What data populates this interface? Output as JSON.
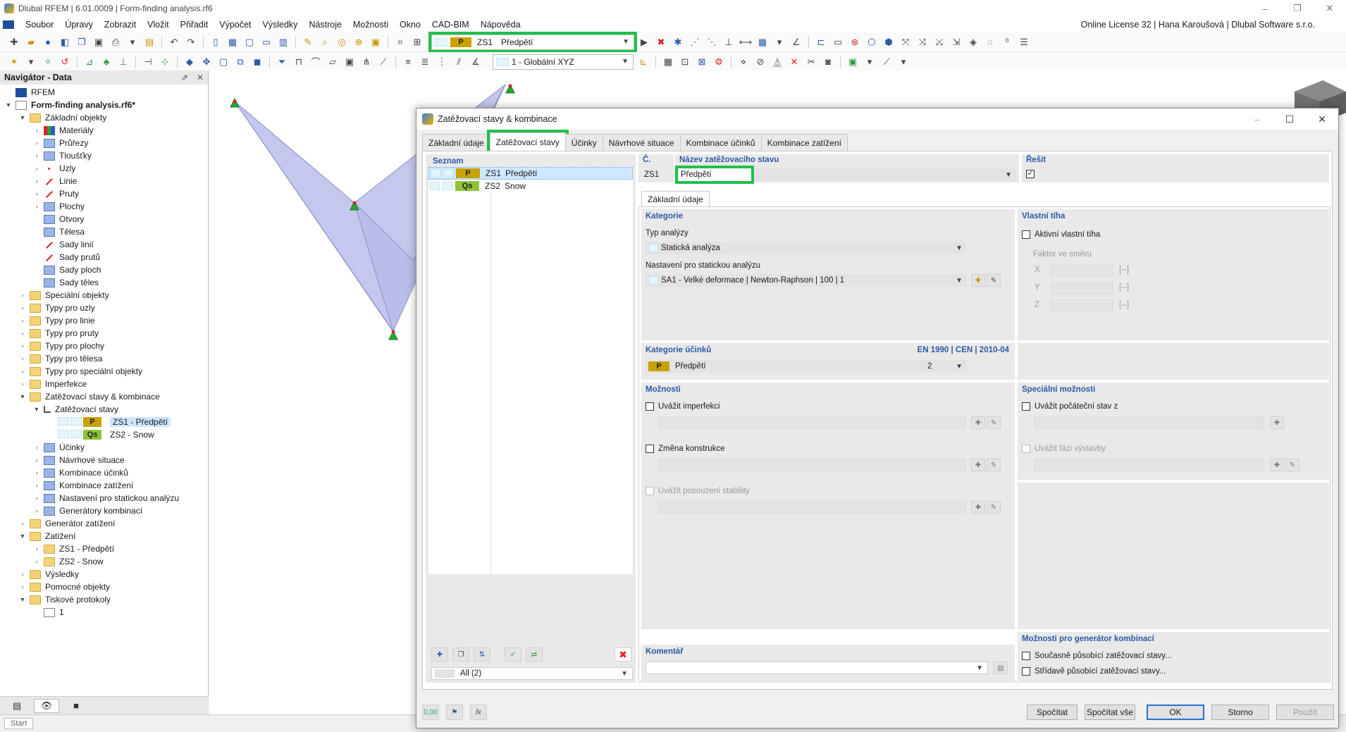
{
  "window": {
    "title": "Dlubal RFEM | 6.01.0009 | Form-finding analysis.rf6",
    "controls": [
      "–",
      "❐",
      "✕"
    ]
  },
  "menu": {
    "items": [
      "Soubor",
      "Úpravy",
      "Zobrazit",
      "Vložit",
      "Přiřadit",
      "Výpočet",
      "Výsledky",
      "Nástroje",
      "Možnosti",
      "Okno",
      "CAD-BIM",
      "Nápověda"
    ],
    "license": "Online License 32 | Hana Karoušová | Dlubal Software s.r.o."
  },
  "toolbar": {
    "lc_selector": {
      "tag": "P",
      "code": "ZS1",
      "name": "Předpětí"
    },
    "coord_system": "1 - Globální XYZ"
  },
  "navigator": {
    "title": "Navigátor - Data",
    "tree": [
      {
        "label": "RFEM",
        "level": 0,
        "exp": "",
        "icon": "rfem"
      },
      {
        "label": "Form-finding analysis.rf6*",
        "level": 0,
        "exp": "▼",
        "icon": "file",
        "bold": true
      },
      {
        "label": "Základní objekty",
        "level": 1,
        "exp": "▼",
        "icon": "folder"
      },
      {
        "label": "Materiály",
        "level": 2,
        "exp": "›",
        "icon": "mat"
      },
      {
        "label": "Průřezy",
        "level": 2,
        "exp": "›",
        "icon": "gen"
      },
      {
        "label": "Tloušťky",
        "level": 2,
        "exp": "›",
        "icon": "gen"
      },
      {
        "label": "Uzly",
        "level": 2,
        "exp": "›",
        "icon": "dot"
      },
      {
        "label": "Linie",
        "level": 2,
        "exp": "›",
        "icon": "red"
      },
      {
        "label": "Pruty",
        "level": 2,
        "exp": "›",
        "icon": "red"
      },
      {
        "label": "Plochy",
        "level": 2,
        "exp": "›",
        "icon": "gen"
      },
      {
        "label": "Otvory",
        "level": 2,
        "exp": "",
        "icon": "gen"
      },
      {
        "label": "Tělesa",
        "level": 2,
        "exp": "",
        "icon": "gen"
      },
      {
        "label": "Sady linií",
        "level": 2,
        "exp": "",
        "icon": "red"
      },
      {
        "label": "Sady prutů",
        "level": 2,
        "exp": "",
        "icon": "red"
      },
      {
        "label": "Sady ploch",
        "level": 2,
        "exp": "",
        "icon": "gen"
      },
      {
        "label": "Sady těles",
        "level": 2,
        "exp": "",
        "icon": "gen"
      },
      {
        "label": "Speciální objekty",
        "level": 1,
        "exp": "›",
        "icon": "folder"
      },
      {
        "label": "Typy pro uzly",
        "level": 1,
        "exp": "›",
        "icon": "folder"
      },
      {
        "label": "Typy pro linie",
        "level": 1,
        "exp": "›",
        "icon": "folder"
      },
      {
        "label": "Typy pro pruty",
        "level": 1,
        "exp": "›",
        "icon": "folder"
      },
      {
        "label": "Typy pro plochy",
        "level": 1,
        "exp": "›",
        "icon": "folder"
      },
      {
        "label": "Typy pro tělesa",
        "level": 1,
        "exp": "›",
        "icon": "folder"
      },
      {
        "label": "Typy pro speciální objekty",
        "level": 1,
        "exp": "›",
        "icon": "folder"
      },
      {
        "label": "Imperfekce",
        "level": 1,
        "exp": "›",
        "icon": "folder"
      },
      {
        "label": "Zatěžovací stavy & kombinace",
        "level": 1,
        "exp": "▼",
        "icon": "folder"
      },
      {
        "label": "Zatěžovací stavy",
        "level": 2,
        "exp": "▼",
        "icon": "lc"
      },
      {
        "label": "ZS1 - Předpětí",
        "level": 3,
        "exp": "",
        "icon": "lc-p",
        "tag": "P",
        "selected": true
      },
      {
        "label": "ZS2 - Snow",
        "level": 3,
        "exp": "",
        "icon": "lc-qs",
        "tag": "Qs"
      },
      {
        "label": "Účinky",
        "level": 2,
        "exp": "›",
        "icon": "gen"
      },
      {
        "label": "Návrhové situace",
        "level": 2,
        "exp": "›",
        "icon": "gen"
      },
      {
        "label": "Kombinace účinků",
        "level": 2,
        "exp": "›",
        "icon": "gen"
      },
      {
        "label": "Kombinace zatížení",
        "level": 2,
        "exp": "›",
        "icon": "gen"
      },
      {
        "label": "Nastavení pro statickou analýzu",
        "level": 2,
        "exp": "›",
        "icon": "gen"
      },
      {
        "label": "Generátory kombinací",
        "level": 2,
        "exp": "›",
        "icon": "gen"
      },
      {
        "label": "Generátor zatížení",
        "level": 1,
        "exp": "›",
        "icon": "folder"
      },
      {
        "label": "Zatížení",
        "level": 1,
        "exp": "▼",
        "icon": "folder"
      },
      {
        "label": "ZS1 - Předpětí",
        "level": 2,
        "exp": "›",
        "icon": "folder"
      },
      {
        "label": "ZS2 - Snow",
        "level": 2,
        "exp": "›",
        "icon": "folder"
      },
      {
        "label": "Výsledky",
        "level": 1,
        "exp": "›",
        "icon": "folder"
      },
      {
        "label": "Pomocné objekty",
        "level": 1,
        "exp": "›",
        "icon": "folder"
      },
      {
        "label": "Tiskové protokoly",
        "level": 1,
        "exp": "▼",
        "icon": "folder"
      },
      {
        "label": "1",
        "level": 2,
        "exp": "",
        "icon": "file"
      }
    ]
  },
  "statusbar": {
    "start": "Start"
  },
  "dialog": {
    "title": "Zatěžovací stavy & kombinace",
    "tabs": [
      "Základní údaje",
      "Zatěžovací stavy",
      "Účinky",
      "Návrhové situace",
      "Kombinace účinků",
      "Kombinace zatížení"
    ],
    "active_tab": 1,
    "list": {
      "header": "Seznam",
      "items": [
        {
          "tag": "P",
          "code": "ZS1",
          "name": "Předpětí",
          "selected": true
        },
        {
          "tag": "Qs",
          "code": "ZS2",
          "name": "Snow",
          "selected": false
        }
      ],
      "filter": "All (2)"
    },
    "number_label": "Č.",
    "number_value": "ZS1",
    "name_label": "Název zatěžovacího stavu",
    "name_value": "Předpětí",
    "solve_label": "Řešit",
    "solve_checked": true,
    "subtab": "Základní údaje",
    "category": {
      "head": "Kategorie",
      "analysis_type_label": "Typ analýzy",
      "analysis_type": "Statická analýza",
      "static_settings_label": "Nastavení pro statickou analýzu",
      "static_settings": "SA1 - Velké deformace | Newton-Raphson | 100 | 1"
    },
    "self_weight": {
      "head": "Vlastní tíha",
      "active_label": "Aktivní vlastní tíha",
      "factor_label": "Faktor ve směru",
      "axes": [
        "X",
        "Y",
        "Z"
      ],
      "unit": "[--]"
    },
    "action_category": {
      "head": "Kategorie účinků",
      "norm": "EN 1990 | CEN | 2010-04",
      "tag": "P",
      "value": "Předpětí",
      "number": "2"
    },
    "options": {
      "head": "Možnosti",
      "imperfection": "Uvážit imperfekci",
      "structure_change": "Změna konstrukce",
      "stability": "Uvážit posouzení stability"
    },
    "special_options": {
      "head": "Speciální možnosti",
      "initial_state": "Uvážit počáteční stav z",
      "construction_stage": "Uvážit fázi výstavby"
    },
    "combo_options": {
      "head": "Možnosti pro generátor kombinací",
      "simultaneous": "Současně působící zatěžovací stavy...",
      "alternating": "Střídavě působící zatěžovací stavy..."
    },
    "comment_label": "Komentář",
    "bottom_left_value": "0,00",
    "buttons": {
      "calculate": "Spočítat",
      "calculate_all": "Spočítat vše",
      "ok": "OK",
      "cancel": "Storno",
      "apply": "Použít"
    }
  },
  "colors": {
    "highlight": "#21c04a",
    "tag_p": "#c9a100",
    "tag_qs": "#8fc23a",
    "accent": "#2b5aa8"
  }
}
